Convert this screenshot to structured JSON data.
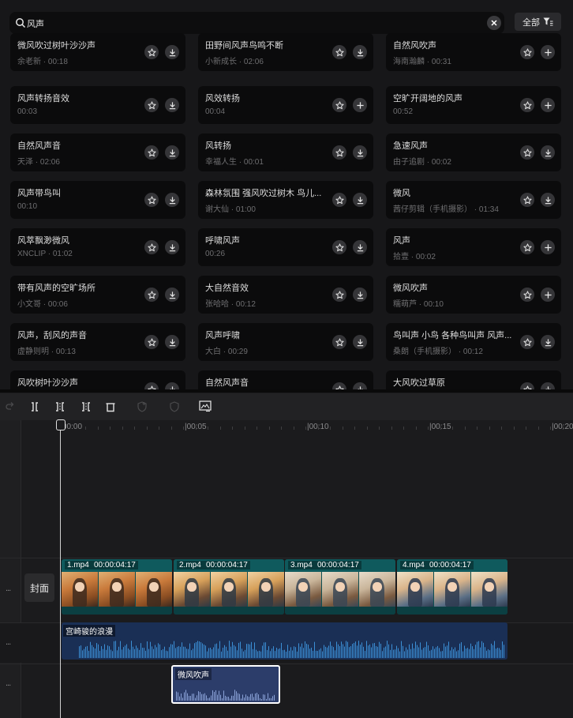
{
  "search": {
    "query": "风声"
  },
  "filter": {
    "label": "全部"
  },
  "cards": [
    {
      "title": "微风吹过树叶沙沙声",
      "meta": "余老新 · 00:18",
      "action": "download"
    },
    {
      "title": "田野间风声鸟鸣不断",
      "meta": "小新成长 · 02:06",
      "action": "download"
    },
    {
      "title": "自然风吹声",
      "meta": "海南瀚麟 · 00:31",
      "action": "add"
    },
    {
      "title": "风声转扬音效",
      "meta": "00:03",
      "action": "download"
    },
    {
      "title": "风效转扬",
      "meta": "00:04",
      "action": "add"
    },
    {
      "title": "空旷开阔地的风声",
      "meta": "00:52",
      "action": "add"
    },
    {
      "title": "自然风声音",
      "meta": "天泽 · 02:06",
      "action": "download"
    },
    {
      "title": "风转扬",
      "meta": "幸福人生 · 00:01",
      "action": "download"
    },
    {
      "title": "急速风声",
      "meta": "由子追剧 · 00:02",
      "action": "download"
    },
    {
      "title": "风声带鸟叫",
      "meta": "00:10",
      "action": "download"
    },
    {
      "title": "森林氛围 强风吹过树木 鸟儿...",
      "meta": "谢大仙 · 01:00",
      "action": "download"
    },
    {
      "title": "微风",
      "meta": "茜仔剪辑（手机摄影） · 01:34",
      "action": "download"
    },
    {
      "title": "风萃飘渺微风",
      "meta": "XNCLIP · 01:02",
      "action": "download"
    },
    {
      "title": "呼啸风声",
      "meta": "00:26",
      "action": "download"
    },
    {
      "title": "风声",
      "meta": "拾壹 · 00:02",
      "action": "add"
    },
    {
      "title": "带有风声的空旷场所",
      "meta": "小文哥 · 00:06",
      "action": "download"
    },
    {
      "title": "大自然音效",
      "meta": "张哈哈 · 00:12",
      "action": "download"
    },
    {
      "title": "微风吹声",
      "meta": "糯萌芦 · 00:10",
      "action": "add"
    },
    {
      "title": "风声，刮风的声音",
      "meta": "虚静则明 · 00:13",
      "action": "download"
    },
    {
      "title": "风声呼啸",
      "meta": "大白 · 00:29",
      "action": "download"
    },
    {
      "title": "鸟叫声 小鸟 各种鸟叫声 风声...",
      "meta": "桑朗（手机摄影） · 00:12",
      "action": "download"
    },
    {
      "title": "风吹树叶沙沙声",
      "meta": "",
      "action": "download"
    },
    {
      "title": "自然风声音",
      "meta": "",
      "action": "download"
    },
    {
      "title": "大风吹过草原",
      "meta": "",
      "action": "download"
    }
  ],
  "ruler": {
    "labels": [
      "00:00",
      "|00:05",
      "|00:10",
      "|00:15",
      "|00:20"
    ]
  },
  "timeline": {
    "cover_label": "封面",
    "video_clips": [
      {
        "name": "1.mp4",
        "duration": "00:00:04:17"
      },
      {
        "name": "2.mp4",
        "duration": "00:00:04:17"
      },
      {
        "name": "3.mp4",
        "duration": "00:00:04:17"
      },
      {
        "name": "4.mp4",
        "duration": "00:00:04:17"
      }
    ],
    "music_clip": {
      "name": "宫崎骏的浪漫"
    },
    "sfx_clip": {
      "name": "微风吹声"
    },
    "track_menu": "..."
  },
  "colors": {
    "video_clip": "#0e4f52",
    "music_clip": "#1a2f55",
    "waveform": "#3b8fd6",
    "selection": "#ffffff"
  }
}
